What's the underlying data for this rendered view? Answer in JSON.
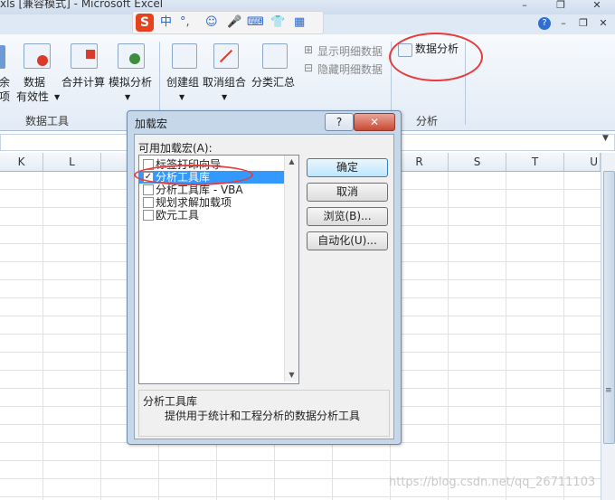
{
  "window": {
    "title": "xls [兼容模式] - Microsoft Excel",
    "help_label": "?",
    "buttons": [
      "–",
      "❐",
      "✕"
    ]
  },
  "ime": {
    "logo": "S",
    "mode": "中",
    "items": [
      "°,",
      "☺",
      "🎤",
      "⌨",
      "👕",
      "▦"
    ]
  },
  "ribbon": {
    "partial_left_top": "余",
    "partial_left_bottom": "项",
    "data_validation": "数据",
    "data_validation_sub": "有效性",
    "consolidate": "合并计算",
    "what_if": "模拟分析",
    "group": "创建组",
    "ungroup": "取消组合",
    "subtotal": "分类汇总",
    "show_detail": "显示明细数据",
    "hide_detail": "隐藏明细数据",
    "data_analysis": "数据分析",
    "group_data_tools": "数据工具",
    "group_analysis": "分析"
  },
  "sheet": {
    "columns": [
      "K",
      "L",
      "R",
      "S",
      "T",
      "U"
    ]
  },
  "dialog": {
    "title": "加载宏",
    "help": "?",
    "close": "✕",
    "available_label": "可用加载宏(A):",
    "addins": [
      {
        "label": "标签打印向导",
        "checked": false,
        "selected": false
      },
      {
        "label": "分析工具库",
        "checked": true,
        "selected": true
      },
      {
        "label": "分析工具库 - VBA",
        "checked": false,
        "selected": false
      },
      {
        "label": "规划求解加载项",
        "checked": false,
        "selected": false
      },
      {
        "label": "欧元工具",
        "checked": false,
        "selected": false
      }
    ],
    "buttons": {
      "ok": "确定",
      "cancel": "取消",
      "browse": "浏览(B)...",
      "automation": "自动化(U)..."
    },
    "description_title": "分析工具库",
    "description_text": "提供用于统计和工程分析的数据分析工具"
  },
  "watermark": "https://blog.csdn.net/qq_26711103",
  "colors": {
    "highlight": "#e83c3c",
    "selection": "#3399ff"
  }
}
